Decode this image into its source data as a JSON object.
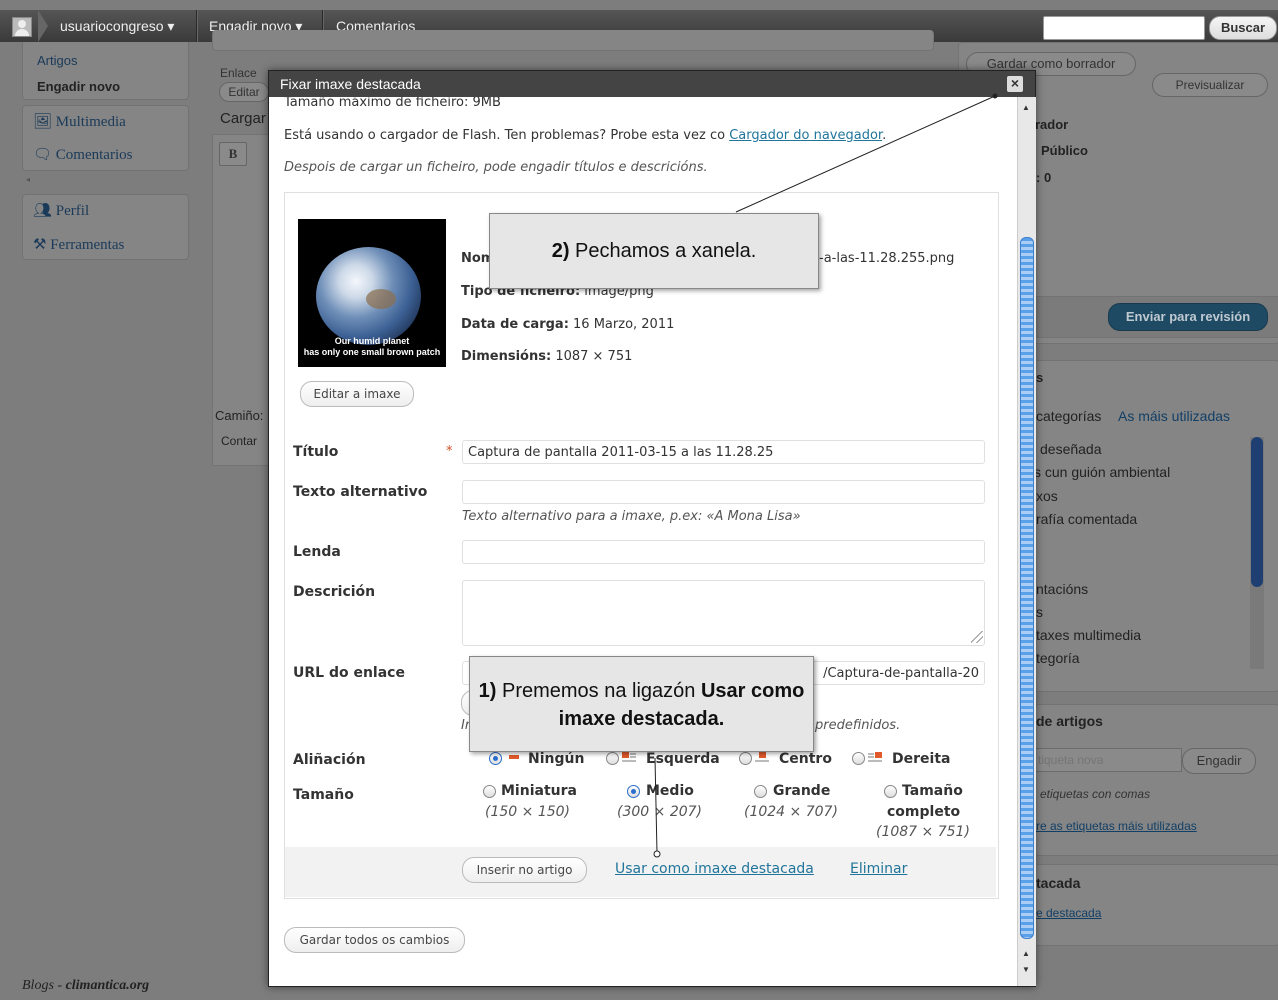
{
  "adminbar": {
    "user": "usuariocongreso ▾",
    "add_new": "Engadir novo ▾",
    "comments": "Comentarios",
    "search_placeholder": "",
    "search_button": "Buscar"
  },
  "sidebar": {
    "posts_sub": [
      {
        "label": "Artigos"
      },
      {
        "label": "Engadir novo"
      }
    ],
    "items": [
      {
        "label": "Multimedia",
        "icon": "media-icon"
      },
      {
        "label": "Comentarios",
        "icon": "comments-icon"
      },
      {
        "label": "Perfil",
        "icon": "profile-icon"
      },
      {
        "label": "Ferramentas",
        "icon": "tools-icon"
      }
    ]
  },
  "background_editor": {
    "link_label": "Enlace",
    "edit_partial": "Editar",
    "upload_partial": "Cargar",
    "bold_btn": "B",
    "path_label": "Camiño:",
    "word_count": "Contar"
  },
  "publish_box": {
    "save_draft": "Gardar como borrador",
    "preview": "Previsualizar",
    "status_partial": "rador",
    "visibility_partial": "Público",
    "revisions_partial": ": 0",
    "submit": "Enviar para revisión"
  },
  "categories_box": {
    "title_partial": "s",
    "tab_all": "categorías",
    "tab_popular": "As máis utilizadas",
    "items": [
      "deseñada",
      "s cun guión ambiental",
      "xos",
      "rafía comentada",
      "",
      "",
      "ntacións",
      "s",
      "taxes multimedia",
      "tegoría"
    ]
  },
  "tags_box": {
    "title_partial": "de artigos",
    "placeholder": "tiqueta nova",
    "add_button": "Engadir",
    "hint": "etiquetas con comas",
    "popular_link": "re as etiquetas máis utilizadas"
  },
  "featured_box": {
    "title_partial": "tacada",
    "link_partial": "e destacada"
  },
  "footer": {
    "brand_prefix": "Blogs - ",
    "brand_name": "climantica.org"
  },
  "modal": {
    "title": "Fixar imaxe destacada",
    "close_glyph": "×",
    "max_size": "Tamaño máximo de ficheiro: 9MB",
    "flash_notice": "Está usando o cargador de Flash. Ten problemas? Probe esta vez co ",
    "browser_uploader_link": "Cargador do navegador",
    "flash_notice_end": ".",
    "after_upload_hint": "Despois de cargar un ficheiro, pode engadir títulos e descricións.",
    "file": {
      "name_label": "Nom",
      "name_value_partial": "-a-las-11.28.255.png",
      "type_label": "Tipo de ficheiro:",
      "type_value": " image/png",
      "date_label": "Data de carga:",
      "date_value": " 16 Marzo, 2011",
      "dims_label": "Dimensións:",
      "dims_value": " 1087 × 751",
      "thumb_caption_1": "Our humid planet",
      "thumb_caption_2": "has only one small brown patch"
    },
    "edit_image_button": "Editar a imaxe",
    "title_label": "Título",
    "required_mark": "*",
    "title_value": "Captura de pantalla 2011-03-15 a las 11.28.25",
    "alt_label": "Texto alternativo",
    "alt_value": "",
    "alt_hint": "Texto alternativo para a imaxe, p.ex: «A Mona Lisa»",
    "caption_label": "Lenda",
    "caption_value": "",
    "description_label": "Descrición",
    "description_value": "",
    "url_label": "URL do enlace",
    "url_value_partial": "/Captura-de-pantalla-20",
    "url_hint_start": "In",
    "url_hint_end": "predefinidos.",
    "alignment_label": "Aliñación",
    "alignment_options": [
      {
        "label": "Ningún",
        "selected": true
      },
      {
        "label": "Esquerda",
        "selected": false
      },
      {
        "label": "Centro",
        "selected": false
      },
      {
        "label": "Dereita",
        "selected": false
      }
    ],
    "size_label": "Tamaño",
    "size_options": [
      {
        "label": "Miniatura",
        "dims": "(150 × 150)",
        "selected": false
      },
      {
        "label": "Medio",
        "dims": "(300 × 207)",
        "selected": true
      },
      {
        "label": "Grande",
        "dims": "(1024 × 707)",
        "selected": false
      },
      {
        "label": "Tamaño",
        "label2": "completo",
        "dims": "(1087 × 751)",
        "selected": false
      }
    ],
    "insert_button": "Inserir no artigo",
    "use_featured_link": "Usar como imaxe destacada",
    "delete_link": "Eliminar",
    "save_all_button": "Gardar todos os cambios"
  },
  "callouts": {
    "step2_num": "2)",
    "step2_text": " Pechamos a xanela.",
    "step1_num": "1)",
    "step1_text": " Prememos na ligazón ",
    "step1_bold": "Usar como imaxe destacada."
  },
  "colors": {
    "admin_bar": "#464646",
    "link": "#21759b",
    "submit_button": "#21759b",
    "required": "#d54e21",
    "callout_bg": "#e6e6e6"
  }
}
